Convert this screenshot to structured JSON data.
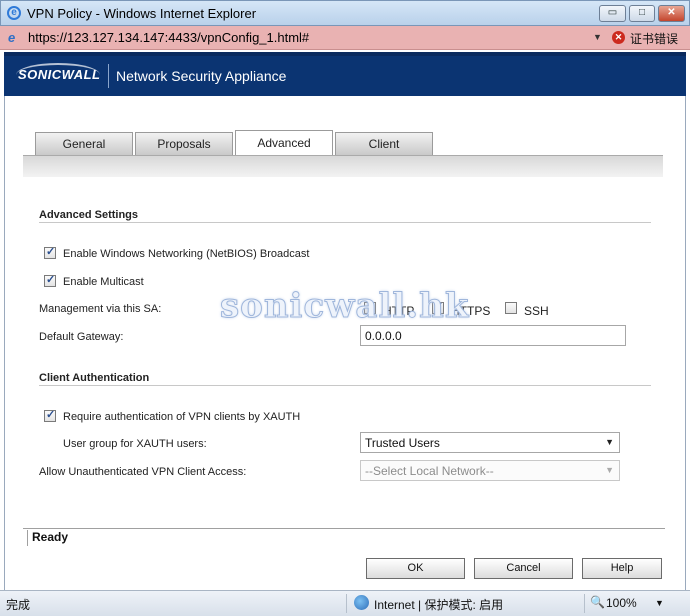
{
  "window": {
    "title": "VPN Policy - Windows Internet Explorer",
    "controls": {
      "minimize": "▭",
      "maximize": "□",
      "close": "✕"
    }
  },
  "address": {
    "url": "https://123.127.134.147:4433/vpnConfig_1.html#",
    "cert_error": "证书错误"
  },
  "header": {
    "logo": "SONICWALL",
    "app_name": "Network Security Appliance",
    "background": "#0b3472"
  },
  "tabs": [
    {
      "label": "General",
      "active": false
    },
    {
      "label": "Proposals",
      "active": false
    },
    {
      "label": "Advanced",
      "active": true
    },
    {
      "label": "Client",
      "active": false
    }
  ],
  "advanced": {
    "section_title": "Advanced Settings",
    "netbios": {
      "label": "Enable Windows Networking (NetBIOS) Broadcast",
      "checked": true
    },
    "multicast": {
      "label": "Enable Multicast",
      "checked": true
    },
    "management": {
      "label": "Management via this SA:",
      "http": {
        "label": "HTTP",
        "checked": true
      },
      "https": {
        "label": "HTTPS",
        "checked": true
      },
      "ssh": {
        "label": "SSH",
        "checked": false
      }
    },
    "gateway": {
      "label": "Default Gateway:",
      "value": "0.0.0.0"
    }
  },
  "client_auth": {
    "section_title": "Client Authentication",
    "xauth": {
      "label": "Require authentication of VPN clients by XAUTH",
      "checked": true
    },
    "user_group": {
      "label": "User group for XAUTH users:",
      "value": "Trusted Users"
    },
    "unauth_access": {
      "label": "Allow Unauthenticated VPN Client Access:",
      "value": "--Select Local Network--",
      "disabled": true
    }
  },
  "watermark": "sonicwall.hk",
  "status": {
    "text": "Ready"
  },
  "buttons": {
    "ok": "OK",
    "cancel": "Cancel",
    "help": "Help"
  },
  "ie_status": {
    "done": "完成",
    "zone": "Internet | 保护模式: 启用",
    "zoom": "100%"
  }
}
